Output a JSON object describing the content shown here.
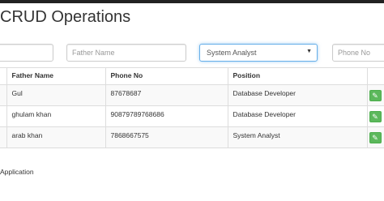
{
  "app": {
    "title": "CRUD Operations"
  },
  "filters": {
    "name_placeholder": "",
    "father_placeholder": "Father Name",
    "position_selected": "System Analyst",
    "phone_placeholder": "Phone No"
  },
  "table": {
    "headers": [
      "",
      "Father Name",
      "Phone No",
      "Position",
      ""
    ],
    "rows": [
      {
        "father": "Gul",
        "phone": "87678687",
        "position": "Database Developer"
      },
      {
        "father": "ghulam khan",
        "phone": "90879789768686",
        "position": "Database Developer"
      },
      {
        "father": "arab khan",
        "phone": "7868667575",
        "position": "System Analyst"
      }
    ]
  },
  "footer": {
    "text": "Application"
  },
  "colors": {
    "edit_button": "#5cb85c",
    "focus_border": "#66afe9"
  },
  "icons": {
    "edit": "pencil-icon",
    "select": "caret-down-icon"
  }
}
